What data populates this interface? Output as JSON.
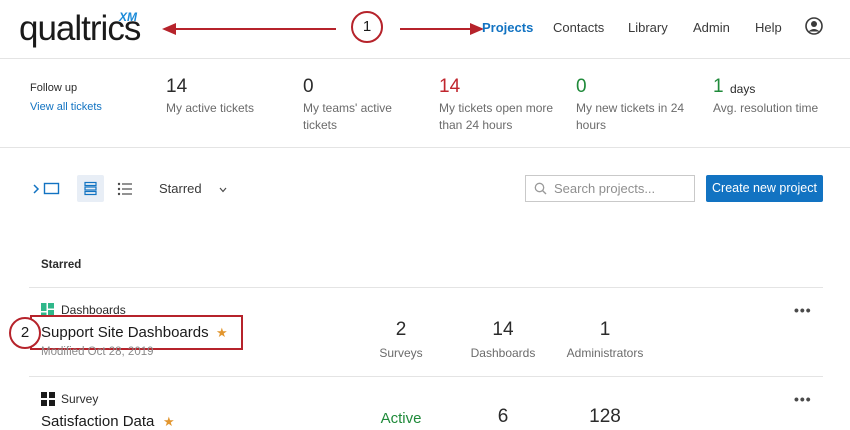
{
  "header": {
    "logo_text": "qualtrics",
    "logo_sup": "XM",
    "nav": [
      "Projects",
      "Contacts",
      "Library",
      "Admin",
      "Help"
    ]
  },
  "annotations": {
    "one": "1",
    "two": "2"
  },
  "stats": {
    "follow_up_label": "Follow up",
    "follow_up_link": "View all tickets",
    "items": [
      {
        "value": "14",
        "label": "My active tickets"
      },
      {
        "value": "0",
        "label": "My teams' active tickets"
      },
      {
        "value": "14",
        "label": "My tickets open more than 24 hours"
      },
      {
        "value": "0",
        "label": "My new tickets in 24 hours"
      },
      {
        "value": "1",
        "unit": "days",
        "label": "Avg. resolution time"
      }
    ]
  },
  "toolbar": {
    "filter_label": "Starred",
    "search_placeholder": "Search projects...",
    "create_button": "Create new project"
  },
  "section_title": "Starred",
  "projects": [
    {
      "type": "Dashboards",
      "name": "Support Site Dashboards",
      "modified": "Modified Oct 28, 2019",
      "cols": [
        {
          "value": "2",
          "label": "Surveys"
        },
        {
          "value": "14",
          "label": "Dashboards"
        },
        {
          "value": "1",
          "label": "Administrators"
        }
      ]
    },
    {
      "type": "Survey",
      "name": "Satisfaction Data",
      "status": "Active",
      "cols": [
        {
          "value": "6"
        },
        {
          "value": "128"
        }
      ]
    }
  ],
  "colors": {
    "accent": "#1273c2",
    "annotation": "#b6232b",
    "star": "#e2962f",
    "red": "#c0262e",
    "green": "#1f8a3a"
  }
}
